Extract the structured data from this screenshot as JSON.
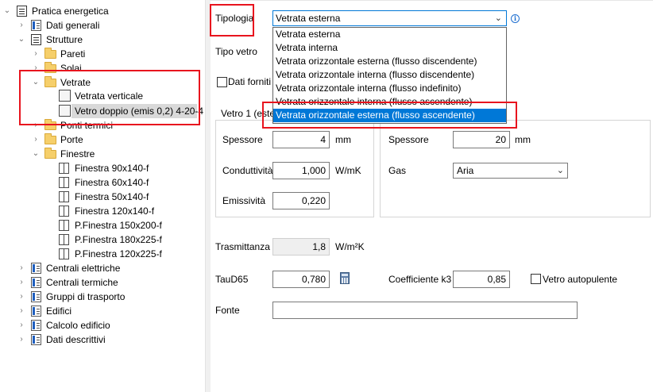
{
  "tree": {
    "root": "Pratica energetica",
    "dati_generali": "Dati generali",
    "strutture": "Strutture",
    "pareti": "Pareti",
    "solai": "Solai",
    "vetrate": "Vetrate",
    "vetrata_verticale": "Vetrata verticale",
    "vetro_doppio": "Vetro doppio (emis 0,2) 4-20-4",
    "ponti_termici": "Ponti termici",
    "porte": "Porte",
    "finestre": "Finestre",
    "finestre_items": [
      "Finestra 90x140-f",
      "Finestra 60x140-f",
      "Finestra 50x140-f",
      "Finestra 120x140-f",
      "P.Finestra 150x200-f",
      "P.Finestra 180x225-f",
      "P.Finestra 120x225-f"
    ],
    "centrali_elettriche": "Centrali elettriche",
    "centrali_termiche": "Centrali termiche",
    "gruppi_trasporto": "Gruppi di trasporto",
    "edifici": "Edifici",
    "calcolo_edificio": "Calcolo edificio",
    "dati_descrittivi": "Dati descrittivi"
  },
  "form": {
    "tipologia_label": "Tipologia",
    "tipologia_value": "Vetrata esterna",
    "tipologia_options": [
      "Vetrata esterna",
      "Vetrata interna",
      "Vetrata orizzontale esterna (flusso discendente)",
      "Vetrata orizzontale interna (flusso discendente)",
      "Vetrata orizzontale interna (flusso indefinito)",
      "Vetrata orizzontale interna (flusso ascendente)",
      "Vetrata orizzontale esterna (flusso ascendente)"
    ],
    "tipo_vetro_label": "Tipo vetro",
    "dati_forniti_label": "Dati forniti",
    "vetro1_legend": "Vetro 1 (este",
    "spessore_label": "Spessore",
    "spessore_value": "4",
    "spessore_unit": "mm",
    "conduttivita_label": "Conduttività",
    "conduttivita_value": "1,000",
    "conduttivita_unit": "W/mK",
    "emissivita_label": "Emissività",
    "emissivita_value": "0,220",
    "gap_spessore_label": "Spessore",
    "gap_spessore_value": "20",
    "gap_spessore_unit": "mm",
    "gas_label": "Gas",
    "gas_value": "Aria",
    "trasmittanza_label": "Trasmittanza",
    "trasmittanza_value": "1,8",
    "trasmittanza_unit": "W/m²K",
    "taud65_label": "TauD65",
    "taud65_value": "0,780",
    "coeff_k3_label": "Coefficiente k3",
    "coeff_k3_value": "0,85",
    "vetro_autopulente_label": "Vetro autopulente",
    "fonte_label": "Fonte",
    "fonte_value": ""
  },
  "colors": {
    "highlight": "#0078d7",
    "annotation": "#e8141e",
    "folder": "#f6cf6a"
  },
  "icons": [
    "document-icon",
    "folder-icon",
    "window-icon",
    "glass-pane-icon",
    "list-icon",
    "info-icon",
    "calculator-icon",
    "chevron-down-icon"
  ]
}
